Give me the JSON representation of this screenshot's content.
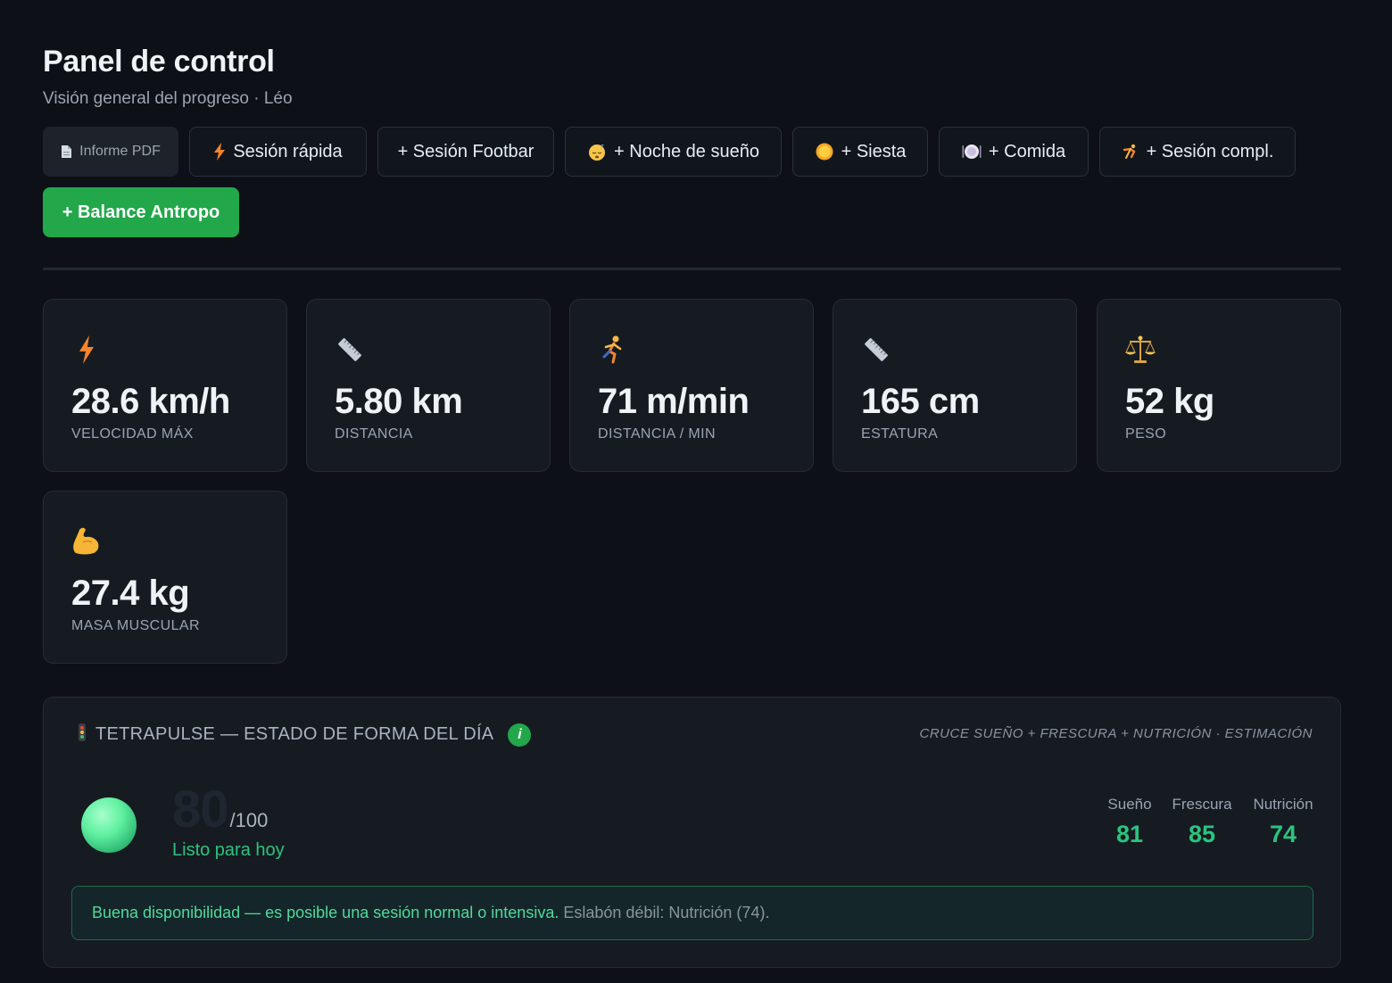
{
  "header": {
    "title": "Panel de control",
    "subtitle": "Visión general del progreso · Léo"
  },
  "toolbar": {
    "pdf": {
      "label": "Informe PDF",
      "icon": "document-icon"
    },
    "quick": {
      "label": "Sesión rápida",
      "icon": "lightning-icon"
    },
    "footbar": {
      "label": "+ Sesión Footbar"
    },
    "sleep": {
      "label": "+ Noche de sueño",
      "icon": "sleeping-face-icon"
    },
    "nap": {
      "label": "+ Siesta",
      "icon": "sun-icon"
    },
    "meal": {
      "label": "+ Comida",
      "icon": "plate-icon"
    },
    "full": {
      "label": "+ Sesión compl.",
      "icon": "person-stretching-icon"
    },
    "anthropo": {
      "label": "+ Balance Antropo",
      "color": "#22a74a"
    }
  },
  "stats": [
    {
      "value": "28.6 km/h",
      "label": "VELOCIDAD MÁX",
      "icon": "lightning-icon"
    },
    {
      "value": "5.80 km",
      "label": "DISTANCIA",
      "icon": "ruler-icon"
    },
    {
      "value": "71 m/min",
      "label": "DISTANCIA / MIN",
      "icon": "runner-icon"
    },
    {
      "value": "165 cm",
      "label": "ESTATURA",
      "icon": "ruler-icon"
    },
    {
      "value": "52 kg",
      "label": "PESO",
      "icon": "scale-icon"
    },
    {
      "value": "27.4 kg",
      "label": "MASA MUSCULAR",
      "icon": "flexed-biceps-icon"
    }
  ],
  "tetrapulse": {
    "title": "TETRAPULSE — ESTADO DE FORMA DEL DÍA",
    "icon": "traffic-light-icon",
    "info": "i",
    "note": "CRUCE SUEÑO + FRESCURA + NUTRICIÓN · ESTIMACIÓN",
    "score": "80",
    "max": "/100",
    "status": "Listo para hoy",
    "subscores": [
      {
        "label": "Sueño",
        "value": "81"
      },
      {
        "label": "Frescura",
        "value": "85"
      },
      {
        "label": "Nutrición",
        "value": "74"
      }
    ],
    "message_good": "Buena disponibilidad — es posible una sesión normal o intensiva.",
    "message_weak": "Eslabón débil: Nutrición (74).",
    "accent": "#2bc47e"
  }
}
